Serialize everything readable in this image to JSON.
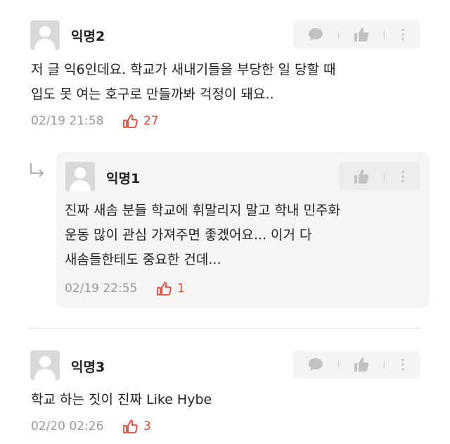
{
  "comments": [
    {
      "author": "익명2",
      "text_lines": [
        "저 글 익6인데요. 학교가 새내기들을 부당한 일 당할 때",
        "입도 못 여는 호구로 만들까봐 걱정이 돼요.."
      ],
      "timestamp": "02/19 21:58",
      "likes": "27"
    },
    {
      "author": "익명1",
      "text_lines": [
        "진짜 새솜 분들 학교에 휘말리지 말고 학내 민주화",
        "운동 많이 관심 가져주면 좋겠어요... 이거 다",
        "새솜들한테도 중요한 건데..."
      ],
      "timestamp": "02/19 22:55",
      "likes": "1"
    },
    {
      "author": "익명3",
      "text_lines": [
        "학교 하는 짓이 진짜 Like Hybe"
      ],
      "timestamp": "02/20 02:26",
      "likes": "3"
    }
  ],
  "icons": {
    "comment": "comment-bubble-icon",
    "like": "thumbs-up-icon",
    "more": "more-vertical-icon",
    "reply": "reply-arrow-icon",
    "avatar": "default-avatar-icon"
  },
  "colors": {
    "like_red": "#e0483a",
    "meta_gray": "#999999",
    "reply_bg": "#f5f5f5"
  }
}
